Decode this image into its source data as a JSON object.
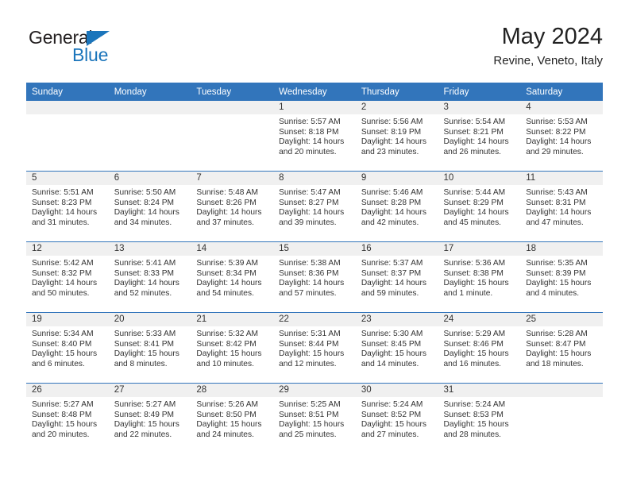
{
  "logo": {
    "word_dark": "General",
    "word_blue": "Blue",
    "triangle_color": "#1b75bb",
    "dark_color": "#231f20"
  },
  "header": {
    "title": "May 2024",
    "subtitle": "Revine, Veneto, Italy"
  },
  "colors": {
    "header_blue": "#3275bb",
    "daynum_band": "#f0f0f0",
    "text": "#333333"
  },
  "weekday_headers": [
    "Sunday",
    "Monday",
    "Tuesday",
    "Wednesday",
    "Thursday",
    "Friday",
    "Saturday"
  ],
  "labels": {
    "sunrise_prefix": "Sunrise:",
    "sunset_prefix": "Sunset:",
    "daylight_prefix": "Daylight:"
  },
  "weeks": [
    [
      {
        "day": "",
        "sunrise": "",
        "sunset": "",
        "daylight": "",
        "empty": true
      },
      {
        "day": "",
        "sunrise": "",
        "sunset": "",
        "daylight": "",
        "empty": true
      },
      {
        "day": "",
        "sunrise": "",
        "sunset": "",
        "daylight": "",
        "empty": true
      },
      {
        "day": "1",
        "sunrise": "Sunrise: 5:57 AM",
        "sunset": "Sunset: 8:18 PM",
        "daylight": "Daylight: 14 hours and 20 minutes.",
        "empty": false
      },
      {
        "day": "2",
        "sunrise": "Sunrise: 5:56 AM",
        "sunset": "Sunset: 8:19 PM",
        "daylight": "Daylight: 14 hours and 23 minutes.",
        "empty": false
      },
      {
        "day": "3",
        "sunrise": "Sunrise: 5:54 AM",
        "sunset": "Sunset: 8:21 PM",
        "daylight": "Daylight: 14 hours and 26 minutes.",
        "empty": false
      },
      {
        "day": "4",
        "sunrise": "Sunrise: 5:53 AM",
        "sunset": "Sunset: 8:22 PM",
        "daylight": "Daylight: 14 hours and 29 minutes.",
        "empty": false
      }
    ],
    [
      {
        "day": "5",
        "sunrise": "Sunrise: 5:51 AM",
        "sunset": "Sunset: 8:23 PM",
        "daylight": "Daylight: 14 hours and 31 minutes.",
        "empty": false
      },
      {
        "day": "6",
        "sunrise": "Sunrise: 5:50 AM",
        "sunset": "Sunset: 8:24 PM",
        "daylight": "Daylight: 14 hours and 34 minutes.",
        "empty": false
      },
      {
        "day": "7",
        "sunrise": "Sunrise: 5:48 AM",
        "sunset": "Sunset: 8:26 PM",
        "daylight": "Daylight: 14 hours and 37 minutes.",
        "empty": false
      },
      {
        "day": "8",
        "sunrise": "Sunrise: 5:47 AM",
        "sunset": "Sunset: 8:27 PM",
        "daylight": "Daylight: 14 hours and 39 minutes.",
        "empty": false
      },
      {
        "day": "9",
        "sunrise": "Sunrise: 5:46 AM",
        "sunset": "Sunset: 8:28 PM",
        "daylight": "Daylight: 14 hours and 42 minutes.",
        "empty": false
      },
      {
        "day": "10",
        "sunrise": "Sunrise: 5:44 AM",
        "sunset": "Sunset: 8:29 PM",
        "daylight": "Daylight: 14 hours and 45 minutes.",
        "empty": false
      },
      {
        "day": "11",
        "sunrise": "Sunrise: 5:43 AM",
        "sunset": "Sunset: 8:31 PM",
        "daylight": "Daylight: 14 hours and 47 minutes.",
        "empty": false
      }
    ],
    [
      {
        "day": "12",
        "sunrise": "Sunrise: 5:42 AM",
        "sunset": "Sunset: 8:32 PM",
        "daylight": "Daylight: 14 hours and 50 minutes.",
        "empty": false
      },
      {
        "day": "13",
        "sunrise": "Sunrise: 5:41 AM",
        "sunset": "Sunset: 8:33 PM",
        "daylight": "Daylight: 14 hours and 52 minutes.",
        "empty": false
      },
      {
        "day": "14",
        "sunrise": "Sunrise: 5:39 AM",
        "sunset": "Sunset: 8:34 PM",
        "daylight": "Daylight: 14 hours and 54 minutes.",
        "empty": false
      },
      {
        "day": "15",
        "sunrise": "Sunrise: 5:38 AM",
        "sunset": "Sunset: 8:36 PM",
        "daylight": "Daylight: 14 hours and 57 minutes.",
        "empty": false
      },
      {
        "day": "16",
        "sunrise": "Sunrise: 5:37 AM",
        "sunset": "Sunset: 8:37 PM",
        "daylight": "Daylight: 14 hours and 59 minutes.",
        "empty": false
      },
      {
        "day": "17",
        "sunrise": "Sunrise: 5:36 AM",
        "sunset": "Sunset: 8:38 PM",
        "daylight": "Daylight: 15 hours and 1 minute.",
        "empty": false
      },
      {
        "day": "18",
        "sunrise": "Sunrise: 5:35 AM",
        "sunset": "Sunset: 8:39 PM",
        "daylight": "Daylight: 15 hours and 4 minutes.",
        "empty": false
      }
    ],
    [
      {
        "day": "19",
        "sunrise": "Sunrise: 5:34 AM",
        "sunset": "Sunset: 8:40 PM",
        "daylight": "Daylight: 15 hours and 6 minutes.",
        "empty": false
      },
      {
        "day": "20",
        "sunrise": "Sunrise: 5:33 AM",
        "sunset": "Sunset: 8:41 PM",
        "daylight": "Daylight: 15 hours and 8 minutes.",
        "empty": false
      },
      {
        "day": "21",
        "sunrise": "Sunrise: 5:32 AM",
        "sunset": "Sunset: 8:42 PM",
        "daylight": "Daylight: 15 hours and 10 minutes.",
        "empty": false
      },
      {
        "day": "22",
        "sunrise": "Sunrise: 5:31 AM",
        "sunset": "Sunset: 8:44 PM",
        "daylight": "Daylight: 15 hours and 12 minutes.",
        "empty": false
      },
      {
        "day": "23",
        "sunrise": "Sunrise: 5:30 AM",
        "sunset": "Sunset: 8:45 PM",
        "daylight": "Daylight: 15 hours and 14 minutes.",
        "empty": false
      },
      {
        "day": "24",
        "sunrise": "Sunrise: 5:29 AM",
        "sunset": "Sunset: 8:46 PM",
        "daylight": "Daylight: 15 hours and 16 minutes.",
        "empty": false
      },
      {
        "day": "25",
        "sunrise": "Sunrise: 5:28 AM",
        "sunset": "Sunset: 8:47 PM",
        "daylight": "Daylight: 15 hours and 18 minutes.",
        "empty": false
      }
    ],
    [
      {
        "day": "26",
        "sunrise": "Sunrise: 5:27 AM",
        "sunset": "Sunset: 8:48 PM",
        "daylight": "Daylight: 15 hours and 20 minutes.",
        "empty": false
      },
      {
        "day": "27",
        "sunrise": "Sunrise: 5:27 AM",
        "sunset": "Sunset: 8:49 PM",
        "daylight": "Daylight: 15 hours and 22 minutes.",
        "empty": false
      },
      {
        "day": "28",
        "sunrise": "Sunrise: 5:26 AM",
        "sunset": "Sunset: 8:50 PM",
        "daylight": "Daylight: 15 hours and 24 minutes.",
        "empty": false
      },
      {
        "day": "29",
        "sunrise": "Sunrise: 5:25 AM",
        "sunset": "Sunset: 8:51 PM",
        "daylight": "Daylight: 15 hours and 25 minutes.",
        "empty": false
      },
      {
        "day": "30",
        "sunrise": "Sunrise: 5:24 AM",
        "sunset": "Sunset: 8:52 PM",
        "daylight": "Daylight: 15 hours and 27 minutes.",
        "empty": false
      },
      {
        "day": "31",
        "sunrise": "Sunrise: 5:24 AM",
        "sunset": "Sunset: 8:53 PM",
        "daylight": "Daylight: 15 hours and 28 minutes.",
        "empty": false
      },
      {
        "day": "",
        "sunrise": "",
        "sunset": "",
        "daylight": "",
        "empty": true
      }
    ]
  ]
}
